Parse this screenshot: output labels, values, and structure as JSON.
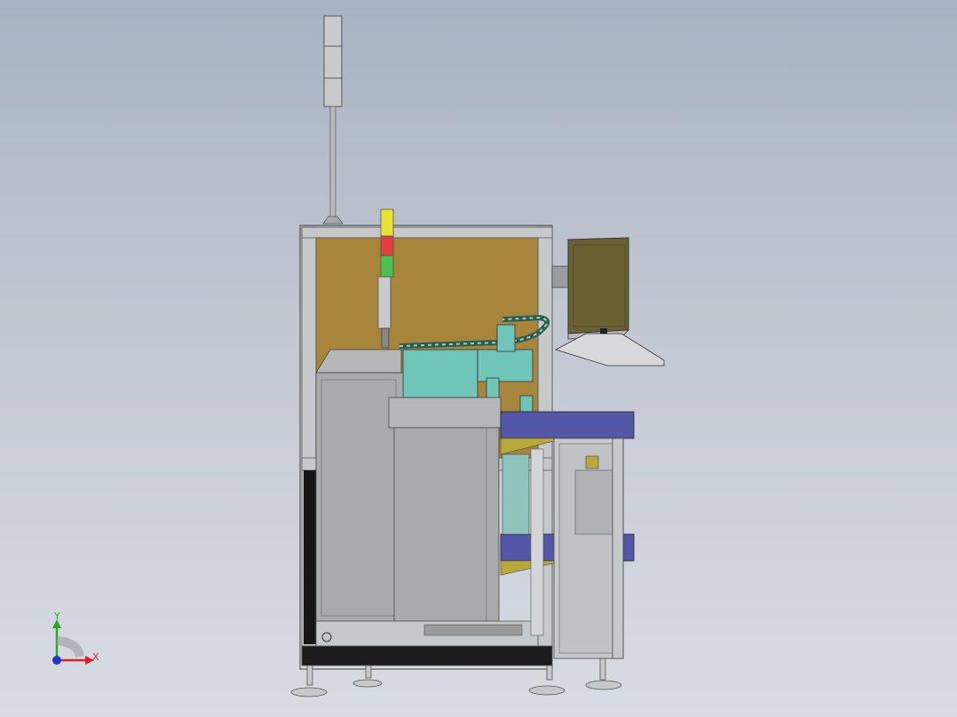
{
  "view": {
    "type": "3d-cad-model-viewport",
    "background_top": "#a8b2c2",
    "background_bottom": "#d8dce3"
  },
  "model": {
    "frame_color": "#c6c9cc",
    "panel_color": "#a7853a",
    "cover_color": "#a9aaab",
    "module_color": "#6ec5b8",
    "conveyor_color": "#5457a8",
    "guide_color": "#b9a93c",
    "monitor_color": "#6a6235",
    "signal_tower_lights": [
      "#e8e23a",
      "#e04040",
      "#4ec04e"
    ]
  },
  "triad": {
    "y_label": "Y",
    "x_label": "X",
    "y_color": "#22aa22",
    "x_color": "#dd2222",
    "z_color": "#2233cc"
  }
}
